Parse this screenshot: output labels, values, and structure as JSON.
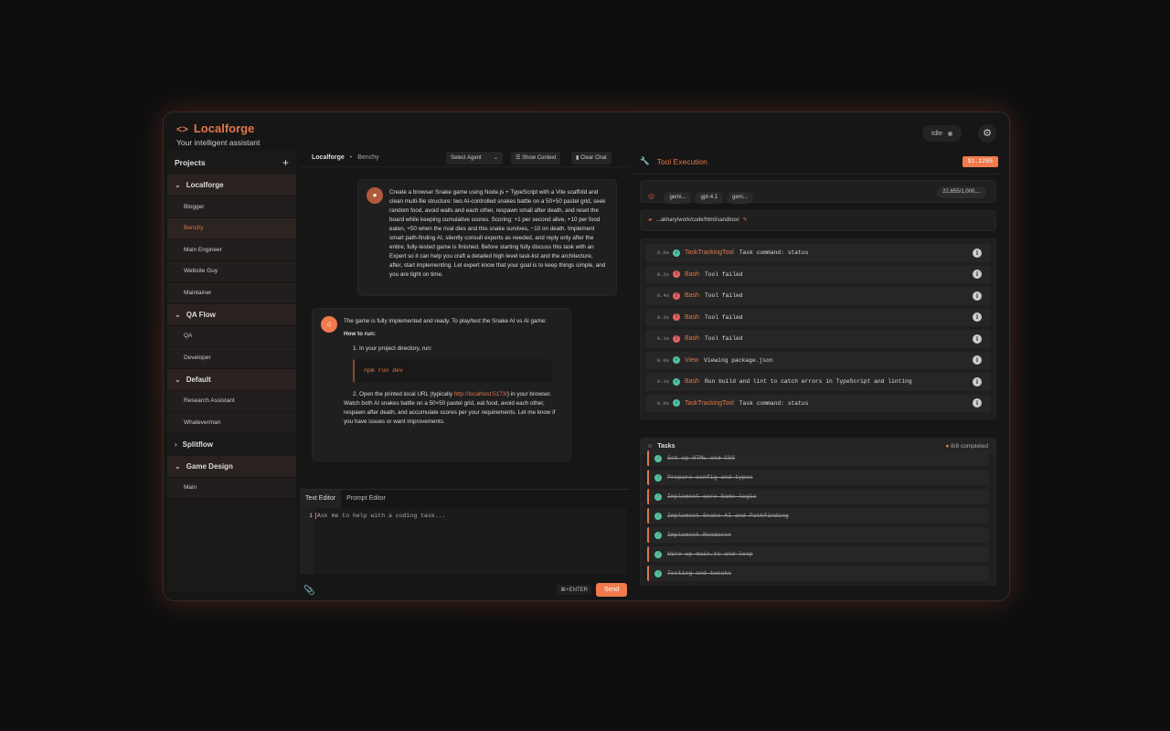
{
  "app": {
    "title": "Localforge",
    "subtitle": "Your intelligent assistant",
    "status": "Idle"
  },
  "sidebar": {
    "header": "Projects",
    "add": "+",
    "groups": [
      {
        "name": "Localforge",
        "expanded": true,
        "items": [
          "Blogger",
          "Benchy",
          "Main Engineer",
          "Website Guy",
          "Maintainer"
        ],
        "active": "Benchy"
      },
      {
        "name": "QA Flow",
        "expanded": true,
        "items": [
          "QA",
          "Developer"
        ]
      },
      {
        "name": "Default",
        "expanded": true,
        "items": [
          "Research Assistant",
          "Whateverman"
        ]
      },
      {
        "name": "Splitflow",
        "expanded": false,
        "items": []
      },
      {
        "name": "Game Design",
        "expanded": true,
        "items": [
          "Main"
        ]
      }
    ]
  },
  "chat": {
    "breadcrumb": [
      "Localforge",
      "Benchy"
    ],
    "select_agent": "Select Agent",
    "show_context": "Show Context",
    "clear_chat": "Clear Chat",
    "user_message": "Create a browser Snake game using Node.js + TypeScript with a Vite scaffold and clean multi-file structure: two AI-controlled snakes battle on a 50×50 pastel grid, seek random food, avoid walls and each other, respawn small after death, and reset the board while keeping cumulative scores. Scoring: +1 per second alive, +10 per food eaten, +50 when the rival dies and this snake survives, −10 on death. Implement smart path-finding AI, silently consult experts as needed, and reply only after the entire, fully-tested game is finished. Before starting fully discuss this task with an Expert so it can help you craft a detailed high level task-list and the architecture, after, start implementing. Let expert know that your goal is to keep things simple, and you are tight on time.",
    "reply": {
      "intro": "The game is fully implemented and ready. To play/test the Snake AI vs AI game:",
      "heading": "How to run:",
      "step1": "1. In your project directory, run:",
      "code": "npm run dev",
      "step2_a": "2. Open the printed local URL (typically ",
      "step2_link": "http://localhost:5173/",
      "step2_b": ") in your browser.",
      "outro": "Watch both AI snakes battle on a 50×50 pastel grid, eat food, avoid each other, respawn after death, and accumulate scores per your requirements. Let me know if you have issues or want improvements."
    },
    "editor": {
      "tabs": [
        "Text Editor",
        "Prompt Editor"
      ],
      "line": "1",
      "placeholder": "Ask me to help with a coding task...",
      "shortcut": "⌘+ENTER",
      "send": "Send"
    }
  },
  "tools": {
    "title": "Tool Execution",
    "cost": "$1.1285",
    "models": [
      "gemi...",
      "gpt-4.1",
      "gem..."
    ],
    "tokens": "22,655/1,000,...",
    "path": "...akhary/work/code/html/sandbox/",
    "rows": [
      {
        "time": "0.0s",
        "status": "ok",
        "name": "TaskTrackingTool",
        "desc": "Task command: status"
      },
      {
        "time": "0.2s",
        "status": "error",
        "name": "Bash",
        "desc": "Tool failed"
      },
      {
        "time": "0.4s",
        "status": "error",
        "name": "Bash",
        "desc": "Tool failed"
      },
      {
        "time": "0.2s",
        "status": "error",
        "name": "Bash",
        "desc": "Tool failed"
      },
      {
        "time": "0.1s",
        "status": "error",
        "name": "Bash",
        "desc": "Tool failed"
      },
      {
        "time": "0.0s",
        "status": "ok",
        "name": "View",
        "desc": "Viewing package.json"
      },
      {
        "time": "0.1s",
        "status": "ok",
        "name": "Bash",
        "desc": "Run build and lint to catch errors in TypeScript and linting"
      },
      {
        "time": "0.0s",
        "status": "ok",
        "name": "TaskTrackingTool",
        "desc": "Task command: status"
      }
    ]
  },
  "tasks": {
    "title": "Tasks",
    "progress": "8/8 completed",
    "items": [
      "Set up HTML and CSS",
      "Prepare config and types",
      "Implement core Game logic",
      "Implement Snake AI and Pathfinding",
      "Implement Renderer",
      "Wire up main.ts and loop",
      "Testing and tweaks"
    ]
  },
  "colors": {
    "accent": "#e0774a",
    "button": "#f07a4c",
    "ok": "#4fc2a0",
    "error": "#e86060"
  }
}
